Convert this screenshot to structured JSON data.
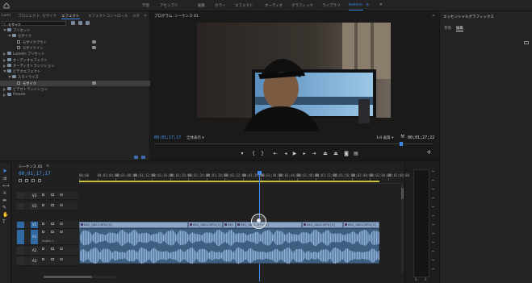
{
  "topbar": {
    "workspaces": [
      "学習",
      "アセンブリ",
      "編集",
      "カラー",
      "エフェクト",
      "オーディオ",
      "グラフィック",
      "ライブラリ",
      "textline"
    ],
    "active_workspace": "textline"
  },
  "project_panel": {
    "tabs": [
      "Lumi",
      "プロジェクト: モザイク",
      "エフェクト",
      "エフェクトコントロール",
      "メタ"
    ],
    "active_tab": "エフェクト",
    "search_value": "モザイク",
    "tree": [
      {
        "label": "プリセット",
        "kind": "folder",
        "depth": 0,
        "open": true
      },
      {
        "label": "モザイク",
        "kind": "folder",
        "depth": 1,
        "open": true
      },
      {
        "label": "モザイクアウト",
        "kind": "preset",
        "depth": 2
      },
      {
        "label": "モザイクイン",
        "kind": "preset",
        "depth": 2
      },
      {
        "label": "Lumetri プリセット",
        "kind": "folder",
        "depth": 0,
        "open": false
      },
      {
        "label": "オーディオエフェクト",
        "kind": "folder",
        "depth": 0,
        "open": false
      },
      {
        "label": "オーディオトランジション",
        "kind": "folder",
        "depth": 0,
        "open": false
      },
      {
        "label": "ビデオエフェクト",
        "kind": "folder",
        "depth": 0,
        "open": true
      },
      {
        "label": "スタイライズ",
        "kind": "folder",
        "depth": 1,
        "open": true
      },
      {
        "label": "モザイク",
        "kind": "preset",
        "depth": 2,
        "selected": true
      },
      {
        "label": "ビデオトランジション",
        "kind": "folder",
        "depth": 0,
        "open": false
      },
      {
        "label": "Presets",
        "kind": "folder",
        "depth": 0,
        "open": false
      }
    ]
  },
  "program_monitor": {
    "title": "プログラム: シーケンス 01",
    "timecode_current": "00;01;17;17",
    "fit_label": "全体表示",
    "quality_label": "1/4 画質",
    "timecode_duration": "00;01;27;22"
  },
  "essential_graphics": {
    "title": "エッセンシャルグラフィックス",
    "tabs": [
      "参照",
      "編集"
    ],
    "active_tab": "編集"
  },
  "timeline": {
    "sequence_tab": "シーケンス 01",
    "timecode": "00;01;17;17",
    "ruler": [
      "00;00",
      "00;01;04;00",
      "00;01;08;00",
      "00;01;12;00",
      "00;01;16;00",
      "00;01;20;00",
      "00;01;24;00",
      "00;01;28;00",
      "00;01;32;00",
      "00;01;36;00",
      "00;01;40;00",
      "00;01;44;00",
      "00;01;48;00",
      "00;01;52;00",
      "00;01;56;00",
      "00;02;00;00",
      "00;02;04;00",
      "00;02;08;00"
    ],
    "tracks": [
      "V3",
      "V2",
      "V1",
      "A1",
      "A2",
      "A3"
    ],
    "clip_names": [
      "IMG_9822.MP4 [V]",
      "IMG_9822.MP4 [V]",
      "IMG",
      "IMG_9822.MP4 [V]",
      "IMG_9822.MP4 [V]",
      "IMG_9822.MP4 [V]"
    ],
    "audio_label": "Audio 1"
  },
  "colors": {
    "accent": "#3d8bf0",
    "video_clip": "#8da5c6",
    "audio_clip": "#3f5f80",
    "waveform": "#8cb0d8"
  }
}
